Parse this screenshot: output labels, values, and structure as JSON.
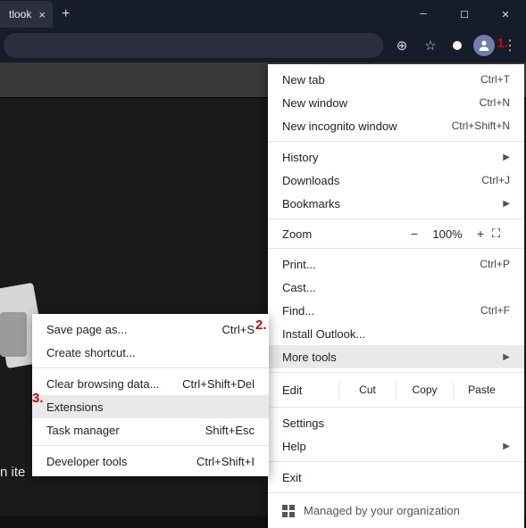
{
  "window": {
    "tab_title": "tlook",
    "tab_close": "×",
    "newtab_glyph": "+",
    "controls": {
      "min": "─",
      "max": "☐",
      "close": "✕"
    }
  },
  "toolbar": {
    "ext_glyph": "⊕",
    "star_glyph": "☆",
    "menu_glyph": "⋮"
  },
  "darkbar": {},
  "content": {
    "partial_text": "n ite"
  },
  "annotations": {
    "a1": "1.",
    "a2": "2.",
    "a3": "3."
  },
  "menu": {
    "new_tab": {
      "label": "New tab",
      "shortcut": "Ctrl+T"
    },
    "new_window": {
      "label": "New window",
      "shortcut": "Ctrl+N"
    },
    "new_incognito": {
      "label": "New incognito window",
      "shortcut": "Ctrl+Shift+N"
    },
    "history": {
      "label": "History"
    },
    "downloads": {
      "label": "Downloads",
      "shortcut": "Ctrl+J"
    },
    "bookmarks": {
      "label": "Bookmarks"
    },
    "zoom": {
      "label": "Zoom",
      "minus": "−",
      "value": "100%",
      "plus": "+",
      "fs": "⛶"
    },
    "print": {
      "label": "Print...",
      "shortcut": "Ctrl+P"
    },
    "cast": {
      "label": "Cast..."
    },
    "find": {
      "label": "Find...",
      "shortcut": "Ctrl+F"
    },
    "install": {
      "label": "Install Outlook..."
    },
    "more_tools": {
      "label": "More tools"
    },
    "edit": {
      "label": "Edit",
      "cut": "Cut",
      "copy": "Copy",
      "paste": "Paste"
    },
    "settings": {
      "label": "Settings"
    },
    "help": {
      "label": "Help"
    },
    "exit": {
      "label": "Exit"
    },
    "managed": {
      "label": "Managed by your organization"
    }
  },
  "submenu": {
    "save_page": {
      "label": "Save page as...",
      "shortcut": "Ctrl+S"
    },
    "create_shortcut": {
      "label": "Create shortcut..."
    },
    "clear_browsing": {
      "label": "Clear browsing data...",
      "shortcut": "Ctrl+Shift+Del"
    },
    "extensions": {
      "label": "Extensions"
    },
    "task_manager": {
      "label": "Task manager",
      "shortcut": "Shift+Esc"
    },
    "developer_tools": {
      "label": "Developer tools",
      "shortcut": "Ctrl+Shift+I"
    }
  }
}
